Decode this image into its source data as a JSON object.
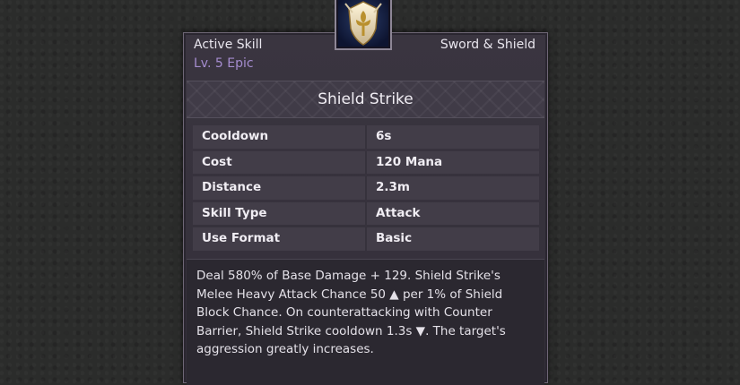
{
  "skill": {
    "kind": "Active Skill",
    "rank": "Lv. 5 Epic",
    "weapon": "Sword & Shield",
    "name": "Shield Strike",
    "icon": "shield-emblem-icon"
  },
  "stats": [
    {
      "label": "Cooldown",
      "value": "6s"
    },
    {
      "label": "Cost",
      "value": "120 Mana"
    },
    {
      "label": "Distance",
      "value": "2.3m"
    },
    {
      "label": "Skill Type",
      "value": "Attack"
    },
    {
      "label": "Use Format",
      "value": "Basic"
    }
  ],
  "description": "Deal 580% of Base Damage + 129. Shield Strike's Melee Heavy Attack Chance 50 ▲ per 1% of Shield Block Chance. On counterattacking with Counter Barrier, Shield Strike cooldown 1.3s ▼. The target's aggression greatly increases.",
  "colors": {
    "rank": "#a58ccf",
    "panel": "#3a3540"
  }
}
